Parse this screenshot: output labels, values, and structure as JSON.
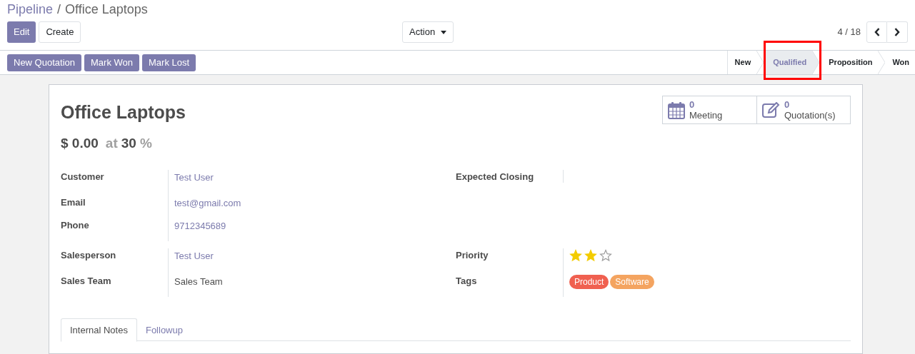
{
  "breadcrumb": [
    {
      "label": "Pipeline",
      "kind": "link"
    },
    {
      "label": "Office Laptops",
      "kind": "current",
      "separator": "/"
    }
  ],
  "buttons": [
    {
      "label": "Edit",
      "kind": "primary"
    },
    {
      "label": "Create",
      "kind": "secondary"
    }
  ],
  "action_menu": {
    "label": "Action"
  },
  "pager": {
    "text": "4 / 18"
  },
  "header_buttons": [
    "New Quotation",
    "Mark Won",
    "Mark Lost"
  ],
  "stages": [
    {
      "label": "New",
      "selected": false,
      "highlighted": false
    },
    {
      "label": "Qualified",
      "selected": true,
      "highlighted": true
    },
    {
      "label": "Proposition",
      "selected": false,
      "highlighted": false
    },
    {
      "label": "Won",
      "selected": false,
      "highlighted": false
    }
  ],
  "smart_buttons": [
    {
      "count": "0",
      "label": "Meeting",
      "kind": "calendar"
    },
    {
      "count": "0",
      "label": "Quotation(s)",
      "kind": "edit"
    }
  ],
  "title": "Office Laptops",
  "amount": {
    "value": "$ 0.00",
    "at": "at",
    "probability": "30",
    "percent": "%"
  },
  "groups": [
    {
      "left": [
        {
          "label": "Customer",
          "kind": "link",
          "value": "Test User"
        },
        {
          "label": "Email",
          "kind": "link",
          "value": "test@gmail.com"
        },
        {
          "label": "Phone",
          "kind": "link",
          "value": "9712345689"
        }
      ],
      "right": [
        {
          "label": "Expected Closing",
          "kind": "empty"
        }
      ]
    },
    {
      "left": [
        {
          "label": "Salesperson",
          "kind": "link",
          "value": "Test User"
        },
        {
          "label": "Sales Team",
          "kind": "text",
          "value": "Sales Team"
        }
      ],
      "right": [
        {
          "label": "Priority",
          "kind": "stars",
          "stars": 2
        },
        {
          "label": "Tags",
          "kind": "tags",
          "tags": [
            {
              "label": "Product",
              "color": "#f06050"
            },
            {
              "label": "Software",
              "color": "#f4a460"
            }
          ]
        }
      ]
    }
  ],
  "tabs": [
    {
      "label": "Internal Notes",
      "selected": true
    },
    {
      "label": "Followup",
      "selected": false
    }
  ]
}
